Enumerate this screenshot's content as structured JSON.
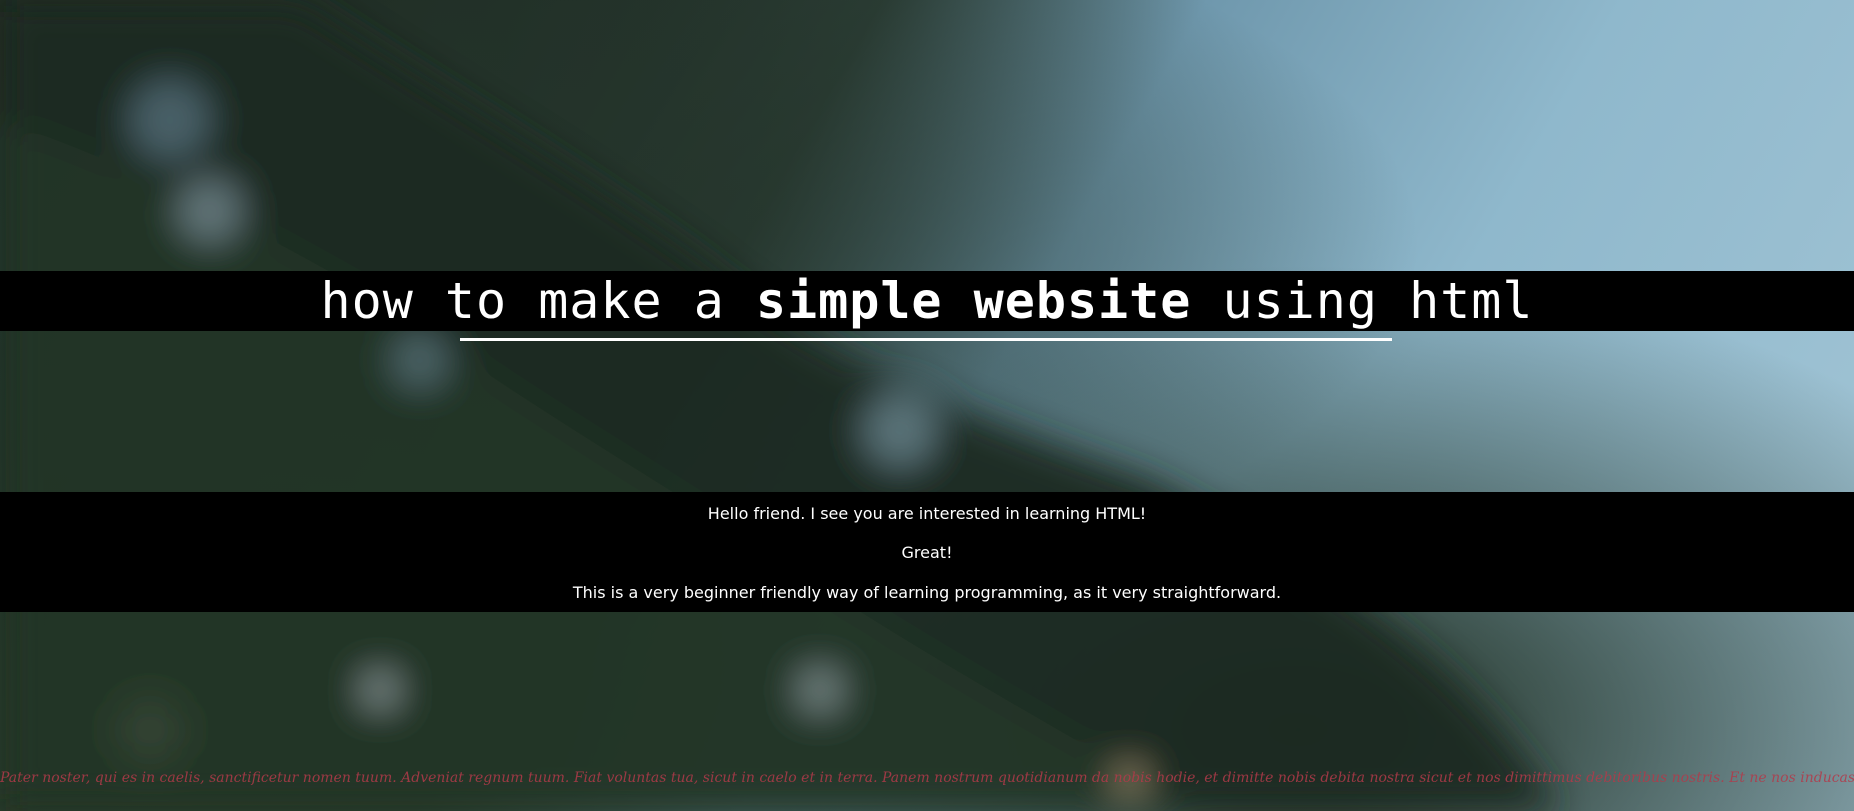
{
  "header": {
    "title_part1": "how to make a ",
    "title_bold": "simple website",
    "title_part2": " using html"
  },
  "intro": {
    "line1": "Hello friend. I see you are interested in learning HTML!",
    "line2": "Great!",
    "line3": "This is a very beginner friendly way of learning programming, as it very straightforward."
  },
  "footer": {
    "text": "Pater noster, qui es in caelis, sanctificetur nomen tuum. Adveniat regnum tuum. Fiat voluntas tua, sicut in caelo et in terra. Panem nostrum quotidianum da nobis hodie, et dimitte nobis debita nostra sicut et nos dimittimus debitoribus nostris. Et ne nos inducas in tentationem, sed libera nos a malo. Amen"
  },
  "colors": {
    "band": "#000000",
    "text": "#ffffff",
    "footer": "#b23a4a"
  }
}
